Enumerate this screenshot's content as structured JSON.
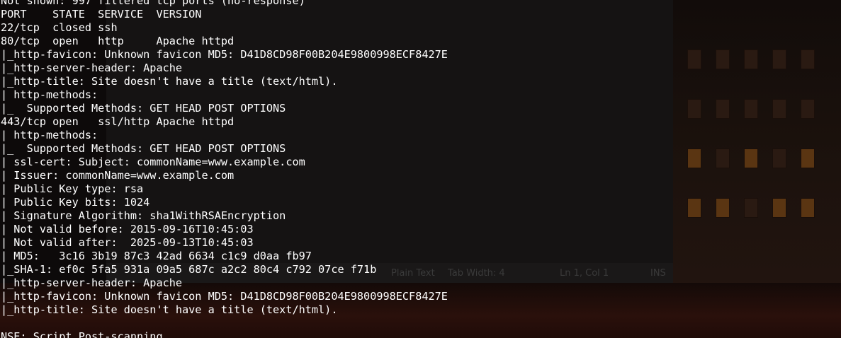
{
  "terminal": {
    "lines": [
      "Not shown: 997 filtered tcp ports (no-response)",
      "PORT    STATE  SERVICE  VERSION",
      "22/tcp  closed ssh",
      "80/tcp  open   http     Apache httpd",
      "|_http-favicon: Unknown favicon MD5: D41D8CD98F00B204E9800998ECF8427E",
      "|_http-server-header: Apache",
      "|_http-title: Site doesn't have a title (text/html).",
      "| http-methods:",
      "|_  Supported Methods: GET HEAD POST OPTIONS",
      "443/tcp open   ssl/http Apache httpd",
      "| http-methods:",
      "|_  Supported Methods: GET HEAD POST OPTIONS",
      "| ssl-cert: Subject: commonName=www.example.com",
      "| Issuer: commonName=www.example.com",
      "| Public Key type: rsa",
      "| Public Key bits: 1024",
      "| Signature Algorithm: sha1WithRSAEncryption",
      "| Not valid before: 2015-09-16T10:45:03",
      "| Not valid after:  2025-09-13T10:45:03",
      "| MD5:   3c16 3b19 87c3 42ad 6634 c1c9 d0aa fb97",
      "|_SHA-1: ef0c 5fa5 931a 09a5 687c a2c2 80c4 c792 07ce f71b",
      "|_http-server-header: Apache",
      "|_http-favicon: Unknown favicon MD5: D41D8CD98F00B204E9800998ECF8427E",
      "|_http-title: Site doesn't have a title (text/html).",
      "",
      "NSE: Script Post-scanning."
    ]
  },
  "background_editor": {
    "statusbar": {
      "language": "Plain Text",
      "tab_width": "Tab Width: 4",
      "position": "Ln 1, Col 1",
      "mode": "INS"
    }
  },
  "colors": {
    "terminal_text": "#ffffff",
    "terminal_bg": "#0d0a0a"
  }
}
